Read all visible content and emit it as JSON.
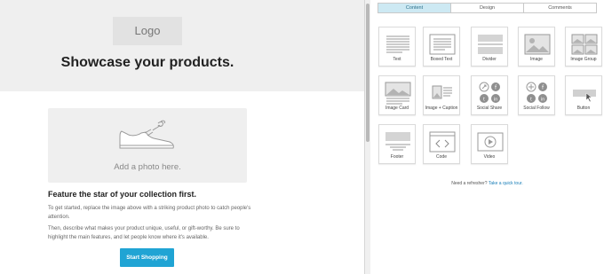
{
  "canvas": {
    "logo_text": "Logo",
    "headline": "Showcase your products.",
    "photo_label": "Add a photo here.",
    "feature_title": "Feature the star of your collection first.",
    "paragraph_1": "To get started, replace the image above with a striking product photo to catch people's attention.",
    "paragraph_2": "Then, describe what makes your product unique, useful, or gift-worthy. Be sure to highlight the main features, and let people know where it's available.",
    "cta_label": "Start Shopping",
    "cta_color": "#20a4d4"
  },
  "panel": {
    "tabs": [
      {
        "label": "Content",
        "active": true
      },
      {
        "label": "Design",
        "active": false
      },
      {
        "label": "Comments",
        "active": false
      }
    ],
    "blocks": [
      {
        "label": "Text",
        "icon": "text-icon"
      },
      {
        "label": "Boxed Text",
        "icon": "boxed-text-icon"
      },
      {
        "label": "Divider",
        "icon": "divider-icon"
      },
      {
        "label": "Image",
        "icon": "image-icon"
      },
      {
        "label": "Image Group",
        "icon": "image-group-icon"
      },
      {
        "label": "Image Card",
        "icon": "image-card-icon"
      },
      {
        "label": "Image + Caption",
        "icon": "image-caption-icon"
      },
      {
        "label": "Social Share",
        "icon": "social-share-icon"
      },
      {
        "label": "Social Follow",
        "icon": "social-follow-icon"
      },
      {
        "label": "Button",
        "icon": "button-icon"
      },
      {
        "label": "Footer",
        "icon": "footer-icon"
      },
      {
        "label": "Code",
        "icon": "code-icon"
      },
      {
        "label": "Video",
        "icon": "video-icon"
      }
    ],
    "help_text": "Need a refresher?",
    "help_link": "Take a quick tour."
  }
}
